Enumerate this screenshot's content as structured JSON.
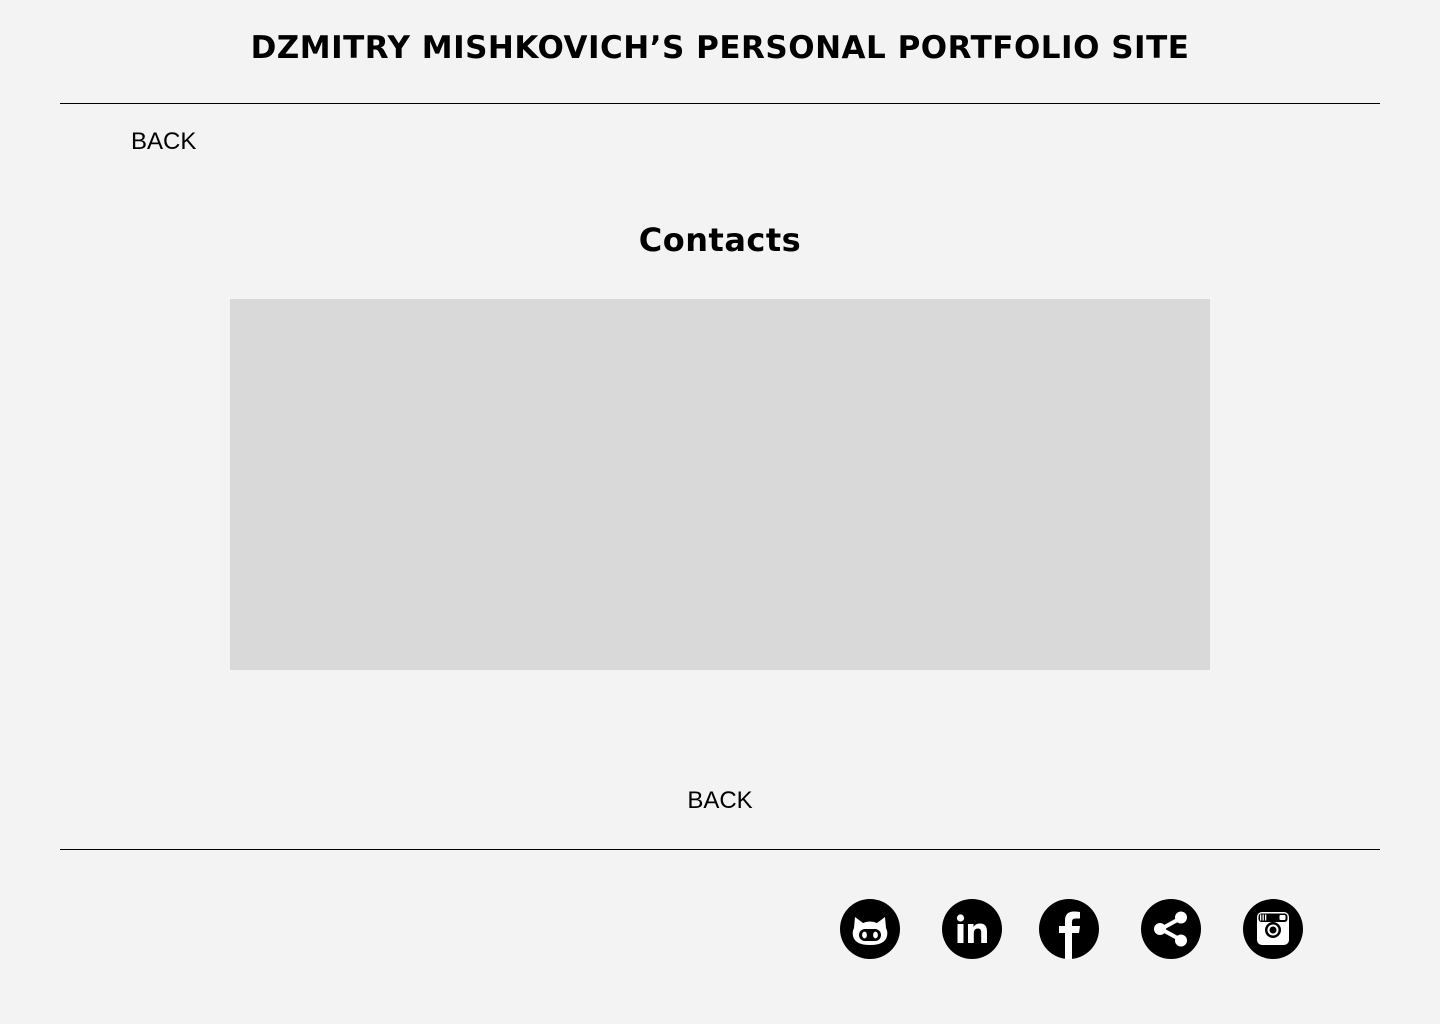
{
  "header": {
    "title": "DZMITRY MISHKOVICH’S PERSONAL PORTFOLIO SITE"
  },
  "nav": {
    "back_top_label": "BACK",
    "back_bottom_label": "BACK"
  },
  "main": {
    "heading": "Contacts"
  },
  "footer": {
    "social_icons": [
      "github-icon",
      "linkedin-icon",
      "facebook-icon",
      "share-icon",
      "instagram-icon"
    ]
  },
  "colors": {
    "background": "#f3f3f3",
    "placeholder": "#d9d9d9",
    "text": "#000000"
  }
}
